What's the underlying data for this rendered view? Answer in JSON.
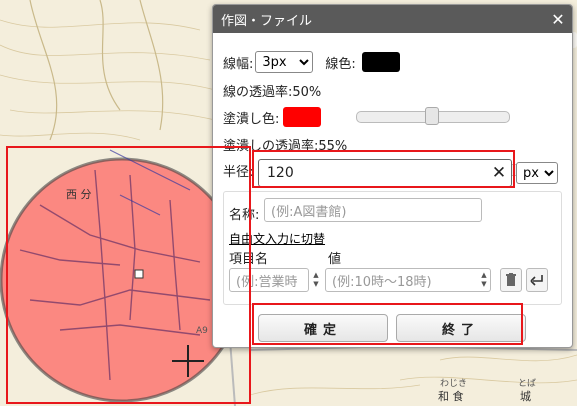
{
  "dialog": {
    "title": "作図・ファイル",
    "close_icon": "close-icon",
    "line_width_label": "線幅:",
    "line_width_value": "3px",
    "line_color_label": "線色:",
    "line_color": "#000000",
    "line_opacity_label": "線の透過率:50%",
    "line_opacity": 0.5,
    "fill_color_label": "塗潰し色:",
    "fill_color": "#ff0000",
    "fill_opacity_label": "塗潰しの透過率:55%",
    "fill_opacity": 0.55,
    "radius_label": "半径:",
    "radius_value": "120",
    "radius_unit": "px",
    "name_label": "名称:",
    "name_placeholder": "(例:A図書館)",
    "free_text_link": "自由文入力に切替",
    "item_name_header": "項目名",
    "value_header": "値",
    "item_name_placeholder": "(例:営業時",
    "value_placeholder": "(例:10時～18時)",
    "trash_icon": "trash-icon",
    "return_icon": "return-icon",
    "confirm_button": "確定",
    "close_button": "終了"
  },
  "map": {
    "labels": {
      "area1": "西 分",
      "area2_reading": "わじき",
      "area2": "和 食",
      "area3_reading": "とば",
      "area3": "城",
      "elevation": "A9"
    },
    "circle_fill": "#ff0000",
    "circle_line": "#000000"
  }
}
